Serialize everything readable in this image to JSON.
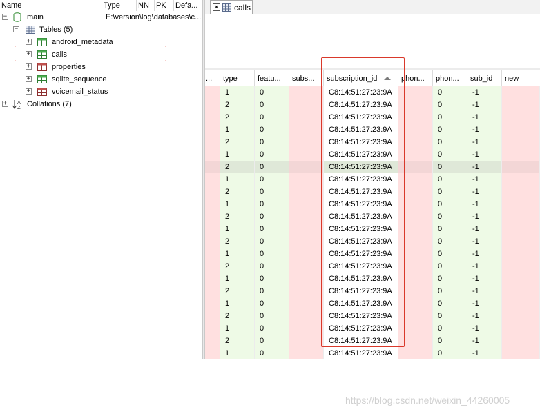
{
  "tree": {
    "columns": [
      "Name",
      "Type",
      "NN",
      "PK",
      "Defa..."
    ],
    "db": {
      "name": "main",
      "type": "E:\\version\\log\\databases\\c..."
    },
    "tables_label": "Tables (5)",
    "tables": [
      "android_metadata",
      "calls",
      "properties",
      "sqlite_sequence",
      "voicemail_status"
    ],
    "collations_label": "Collations (7)"
  },
  "tab": {
    "label": "calls"
  },
  "grid": {
    "columns": [
      "...",
      "type",
      "featu...",
      "subs...",
      "subscription_id",
      "phon...",
      "phon...",
      "sub_id",
      "new"
    ],
    "sorted_column": "subscription_id",
    "types": [
      "1",
      "2",
      "2",
      "1",
      "2",
      "1",
      "2",
      "1",
      "2",
      "1",
      "2",
      "1",
      "2",
      "1",
      "2",
      "1",
      "2",
      "1",
      "2",
      "1",
      "2",
      "1"
    ],
    "features": "0",
    "subscription_id": "C8:14:51:27:23:9A",
    "phone_account_value": "0",
    "sub_id": "-1"
  },
  "watermark": "https://blog.csdn.net/weixin_44260005"
}
